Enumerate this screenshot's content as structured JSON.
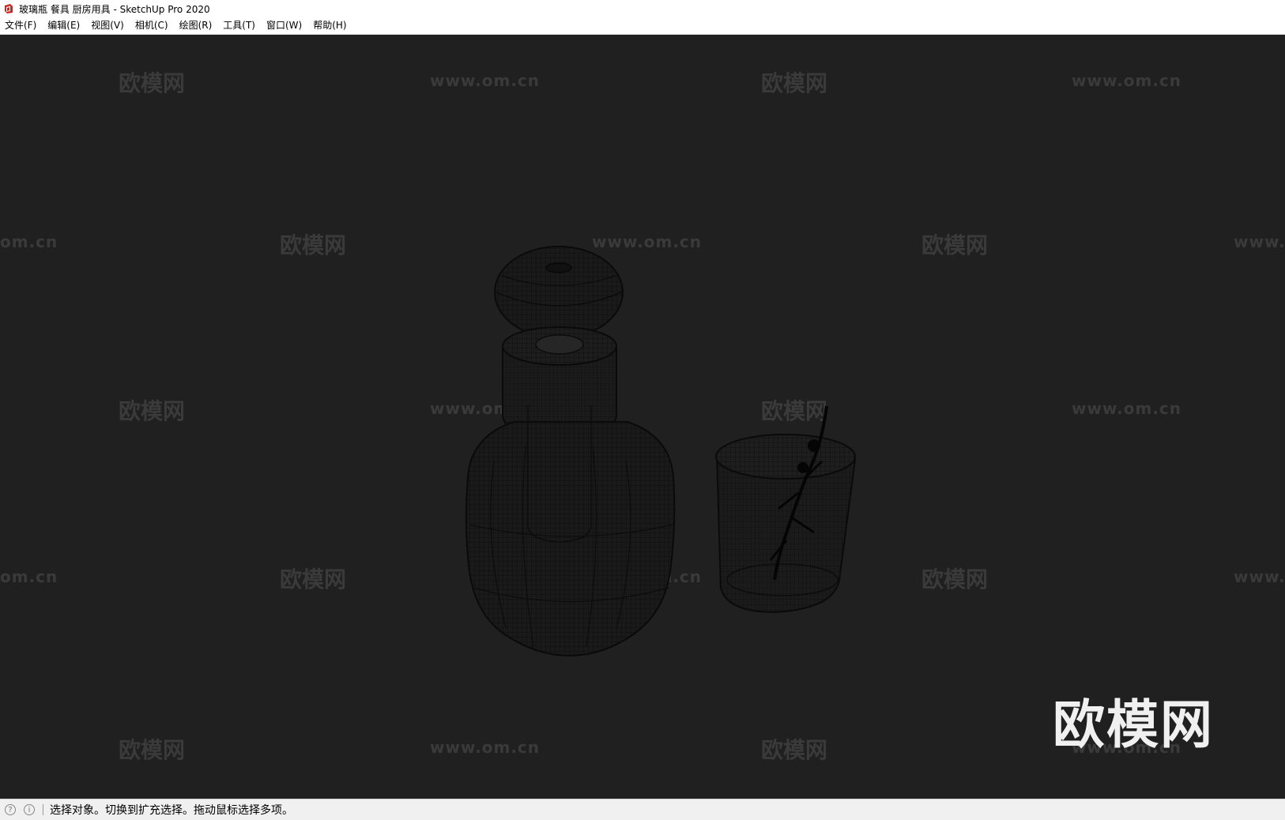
{
  "window": {
    "title": "玻璃瓶 餐具 厨房用具 - SketchUp Pro 2020"
  },
  "menu": {
    "items": [
      "文件(F)",
      "编辑(E)",
      "视图(V)",
      "相机(C)",
      "绘图(R)",
      "工具(T)",
      "窗口(W)",
      "帮助(H)"
    ]
  },
  "viewport": {
    "watermark_cn": "欧模网",
    "watermark_url": "www.om.cn",
    "watermark_url_partial_left": "om.cn",
    "watermark_url_partial_right": "www.",
    "logo": "欧模网",
    "background_color": "#202020"
  },
  "status": {
    "message": "选择对象。切换到扩充选择。拖动鼠标选择多项。"
  },
  "icons": {
    "app": "sketchup-icon",
    "status_left": "geolocation-icon",
    "status_right": "info-icon"
  }
}
